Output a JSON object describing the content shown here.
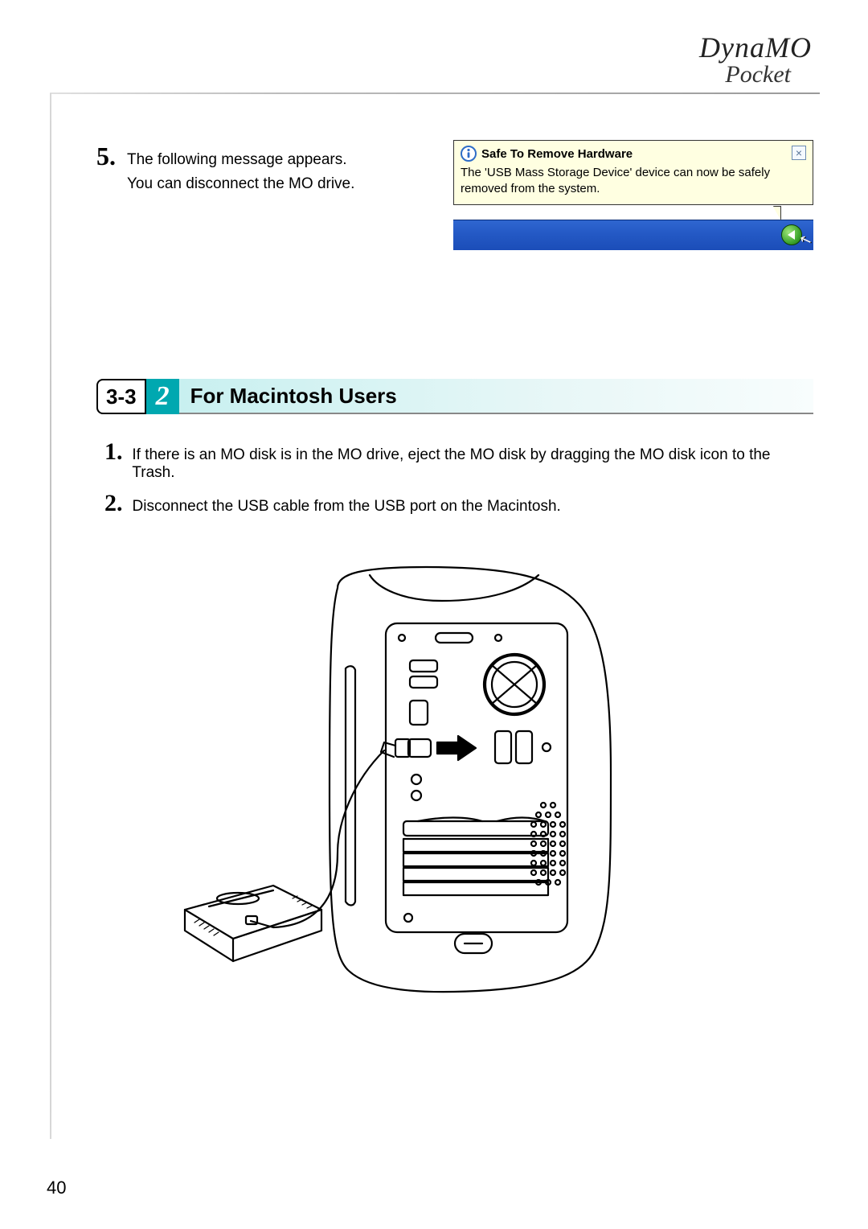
{
  "brand": {
    "line1": "DynaMO",
    "line2": "Pocket"
  },
  "step5": {
    "number": "5.",
    "line1": "The following message appears.",
    "line2": "You can disconnect the MO drive."
  },
  "balloon": {
    "title": "Safe To Remove Hardware",
    "body": "The 'USB Mass Storage Device' device can now be safely removed from the system.",
    "close_glyph": "×"
  },
  "section": {
    "chip1": "3-3",
    "chip2": "2",
    "title": "For Macintosh Users"
  },
  "mac_steps": [
    {
      "num": "1.",
      "text": "If there is an MO disk is in the MO drive, eject the MO disk by dragging the MO disk icon to the Trash."
    },
    {
      "num": "2.",
      "text": "Disconnect the USB cable from the USB port on the Macintosh."
    }
  ],
  "page_number": "40",
  "illustration_alt": "Line drawing of a Macintosh tower rear view with a USB cable connected to an external MO drive; an arrow indicates disconnecting the cable from the USB port."
}
